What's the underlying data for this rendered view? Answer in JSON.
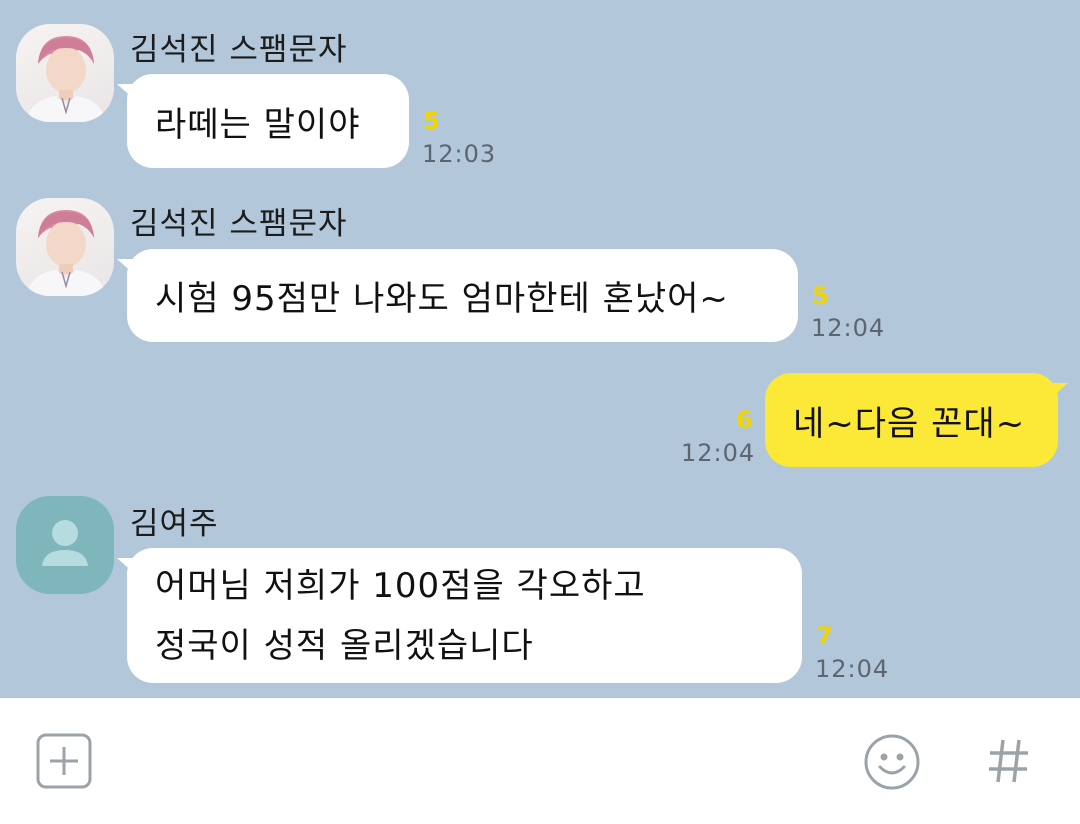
{
  "messages": [
    {
      "sender": "김석진 스팸문자",
      "text": "라떼는 말이야",
      "unread": "5",
      "time": "12:03"
    },
    {
      "sender": "김석진 스팸문자",
      "text": "시험 95점만 나와도 엄마한테 혼났어~",
      "unread": "5",
      "time": "12:04"
    },
    {
      "text": "네~다음 꼰대~",
      "unread": "6",
      "time": "12:04"
    },
    {
      "sender": "김여주",
      "lines": [
        "어머님 저희가 100점을 각오하고",
        "정국이 성적 올리겠습니다"
      ],
      "unread": "7",
      "time": "12:04"
    }
  ],
  "composer": {
    "add_icon": "plus-square-icon",
    "emoji_icon": "smiley-icon",
    "hash_icon": "hash-icon"
  },
  "colors": {
    "chat_background": "#b2c7da",
    "my_bubble": "#fce937",
    "unread_count": "#f2d500"
  }
}
